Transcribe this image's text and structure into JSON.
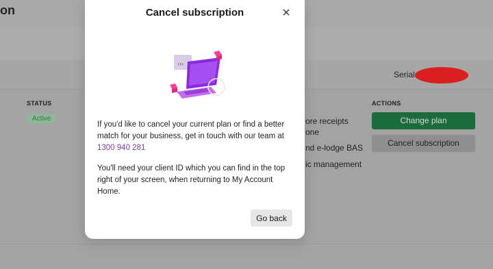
{
  "background": {
    "title_fragment": "on",
    "serial_label": "Serial:",
    "status_header": "STATUS",
    "status_badge": "Active",
    "features": [
      "ore receipts",
      "one",
      "nd e-lodge BAS",
      "ic management"
    ],
    "actions_header": "ACTIONS",
    "change_plan_label": "Change plan",
    "cancel_subscription_label": "Cancel subscription"
  },
  "modal": {
    "title": "Cancel subscription",
    "paragraph1": "If you'd like to cancel your current plan or find a better match for your business, get in touch with our team at",
    "phone": "1300 940 281",
    "paragraph2": "You'll need your client ID which you can find in the top right of your screen, when returning to My Account Home.",
    "go_back_label": "Go back"
  },
  "colors": {
    "accent_purple": "#7b3fa3",
    "primary_green": "#1c6b3d",
    "redaction": "#d91f1f"
  },
  "icons": {
    "close": "close-icon",
    "illustration": "laptop-chat-illustration"
  }
}
